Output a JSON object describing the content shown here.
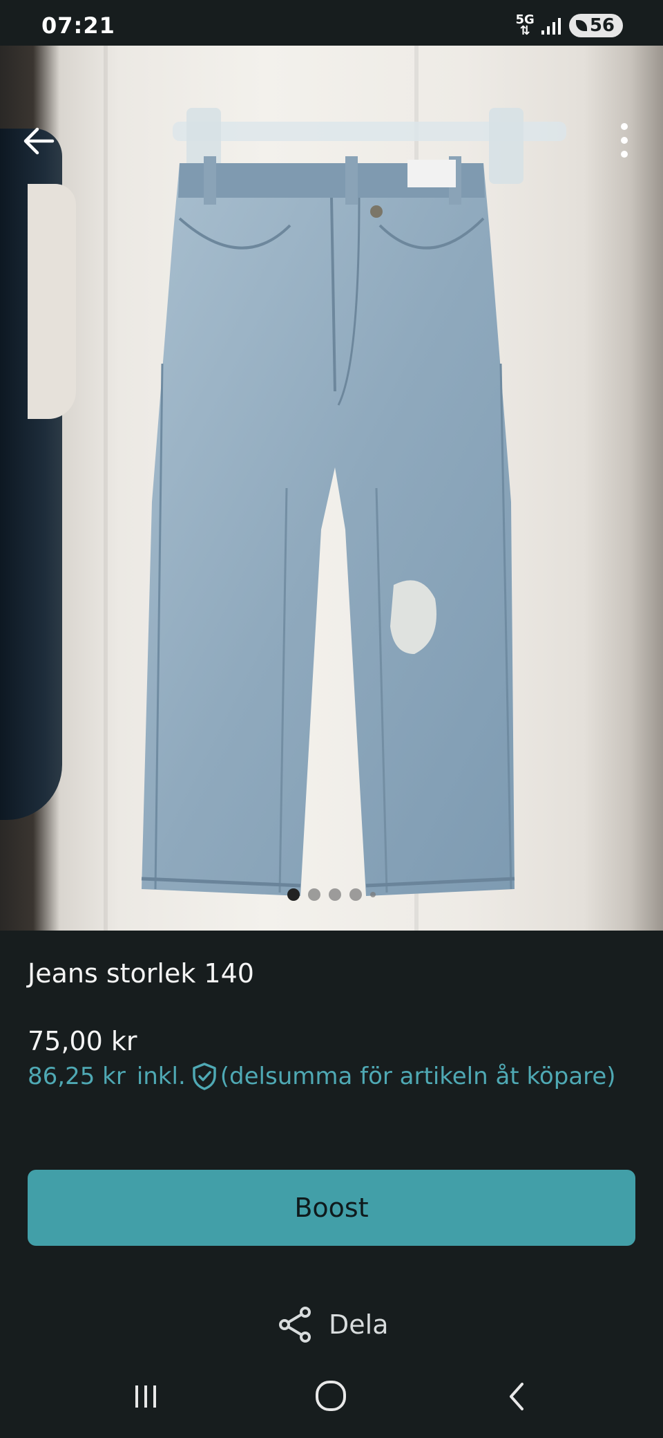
{
  "status_bar": {
    "time": "07:21",
    "network": "5G",
    "battery": "56"
  },
  "listing": {
    "image_count": 5,
    "active_image_index": 0,
    "title": "Jeans storlek 140",
    "price": "75,00 kr",
    "buyer_price": "86,25 kr",
    "inkl_label": "inkl.",
    "buyer_note": "(delsumma för artikeln åt köpare)"
  },
  "actions": {
    "boost_label": "Boost",
    "share_label": "Dela"
  },
  "icons": {
    "back": "arrow-left-icon",
    "more": "more-vertical-icon",
    "shield": "shield-check-icon",
    "share": "share-icon"
  },
  "colors": {
    "background": "#171d1e",
    "accent": "#429fa8",
    "accent_text": "#4fa9b4"
  }
}
